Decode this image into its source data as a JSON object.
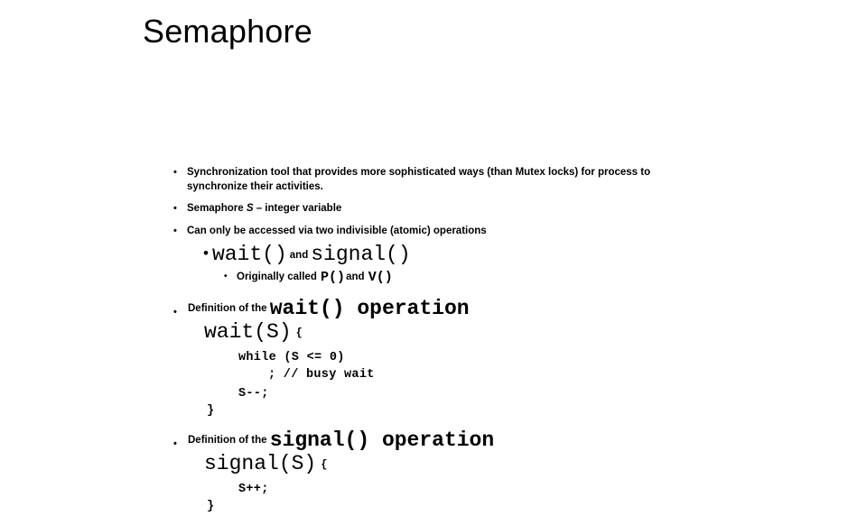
{
  "slide": {
    "title": "Semaphore",
    "bullet_marker": "•",
    "sub_bullet_marker": "•",
    "background_color": "#ffffff",
    "text_color": "#000000"
  },
  "bullets": [
    {
      "text_before": "Synchronization tool that provides more sophisticated ways (than Mutex locks)  for process to synchronize their activities."
    },
    {
      "prefix": "Semaphore ",
      "emphasis": "S",
      "suffix": " – integer variable"
    },
    {
      "text": "Can only be accessed via two indivisible (atomic) operations"
    }
  ],
  "operations_headline": {
    "first_op": "wait()",
    "conjunction": "and",
    "second_op": "signal()"
  },
  "originally_called": {
    "label": "Originally called ",
    "first": "P()",
    "conjunction": "and ",
    "second": "V()"
  },
  "wait_definition": {
    "label": "Definition of  the ",
    "operation": "wait()  operation",
    "signature": "wait(S)",
    "open_brace": "{",
    "code_lines": [
      "while (S <= 0)",
      "; // busy wait",
      "S--;",
      "}"
    ]
  },
  "signal_definition": {
    "label": "Definition of  the ",
    "operation": "signal()  operation",
    "signature": "signal(S)",
    "open_brace": "{",
    "code_lines": [
      "S++;",
      "}"
    ]
  }
}
